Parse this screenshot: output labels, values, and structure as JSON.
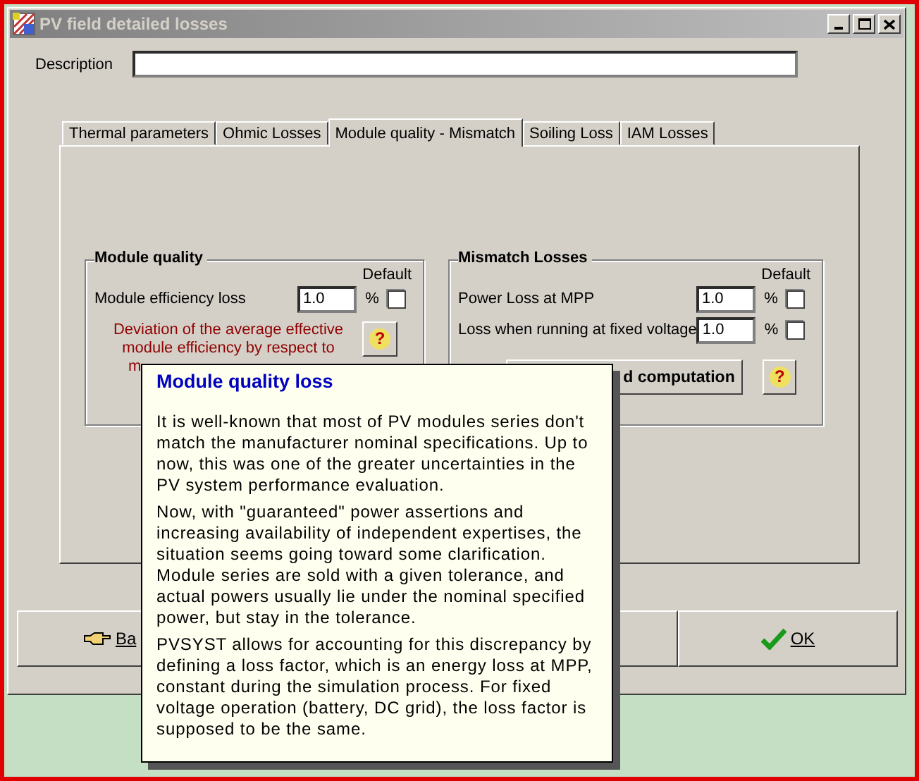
{
  "window": {
    "title": "PV field detailed losses"
  },
  "description": {
    "label": "Description"
  },
  "tabs": [
    {
      "label": "Thermal parameters",
      "selected": false
    },
    {
      "label": "Ohmic Losses",
      "selected": false
    },
    {
      "label": "Module quality - Mismatch",
      "selected": true
    },
    {
      "label": "Soiling Loss",
      "selected": false
    },
    {
      "label": "IAM Losses",
      "selected": false
    }
  ],
  "module_quality": {
    "title": "Module quality",
    "default_header": "Default",
    "rows": [
      {
        "label": "Module efficiency loss",
        "value": "1.0",
        "unit": "%",
        "checked": false
      }
    ],
    "note_lines": [
      "Deviation of the average effective",
      "module efficiency by respect to",
      "m"
    ],
    "help": "?"
  },
  "mismatch_losses": {
    "title": "Mismatch Losses",
    "default_header": "Default",
    "rows": [
      {
        "label": "Power Loss at MPP",
        "value": "1.0",
        "unit": "%",
        "checked": false
      },
      {
        "label": "Loss when running at fixed voltage",
        "value": "1.0",
        "unit": "%",
        "checked": false
      }
    ],
    "button": "d computation",
    "help": "?"
  },
  "buttons": [
    {
      "kind": "back",
      "label": "Ba"
    },
    {
      "kind": "ok",
      "label": "OK"
    }
  ],
  "tooltip": {
    "title": "Module quality loss",
    "paragraphs": [
      "It is well-known that most of PV modules series don't match the manufacturer nominal specifications. Up to now, this was one of the greater uncertainties in the PV system performance evaluation.",
      "Now, with \"guaranteed\" power assertions and increasing availability of independent expertises, the situation seems going toward some clarification. Module series are sold with a given tolerance, and actual powers usually lie under the nominal specified power, but stay in the tolerance.",
      "PVSYST allows for accounting for this discrepancy by defining a loss factor, which is an energy loss at MPP, constant during the simulation process. For fixed voltage operation (battery, DC grid), the loss factor is supposed to be the same."
    ]
  }
}
